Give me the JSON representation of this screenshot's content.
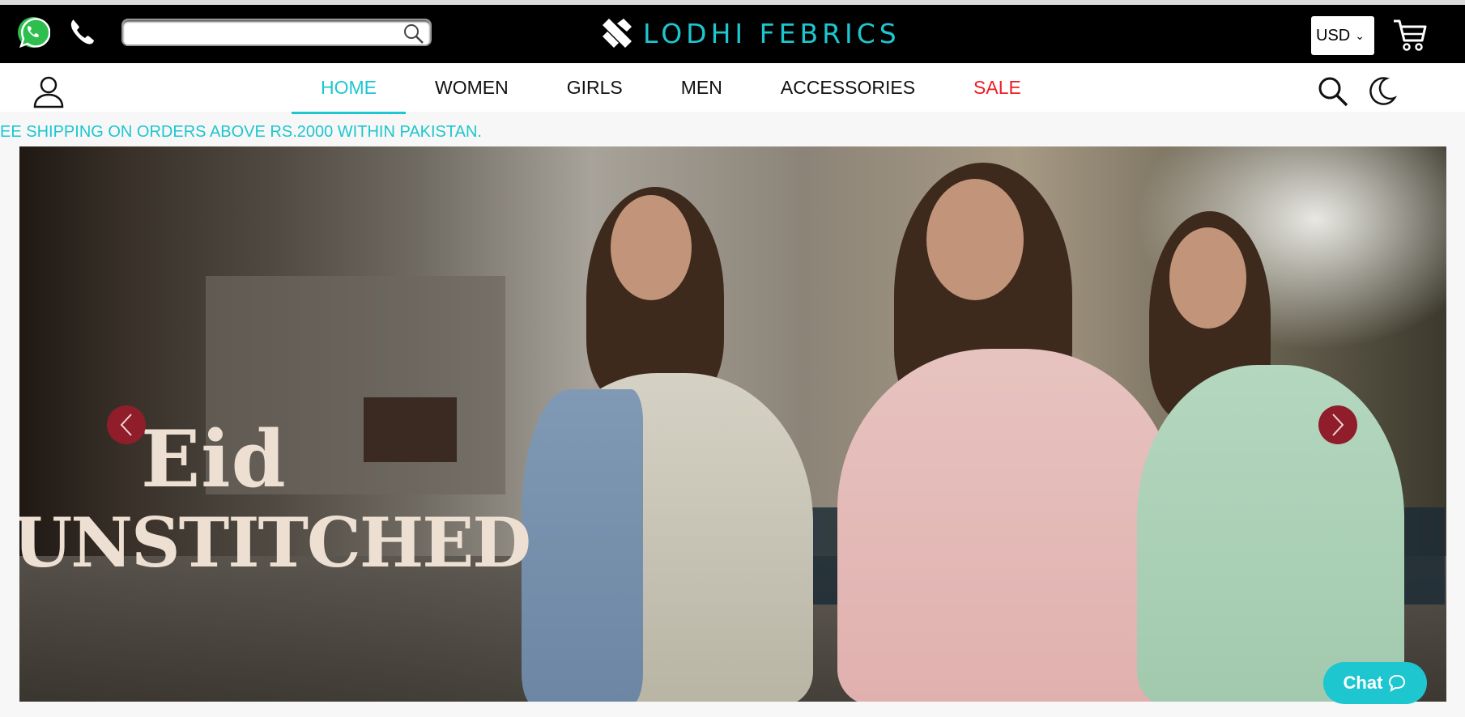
{
  "topbar": {
    "brand": "LODHI FEBRICS",
    "search_placeholder": "",
    "currency": "USD",
    "icons": [
      "whatsapp-icon",
      "phone-icon",
      "search-icon",
      "cart-icon"
    ]
  },
  "nav": {
    "items": [
      {
        "label": "HOME",
        "active": true
      },
      {
        "label": "WOMEN"
      },
      {
        "label": "GIRLS"
      },
      {
        "label": "MEN"
      },
      {
        "label": "ACCESSORIES"
      },
      {
        "label": "SALE"
      }
    ]
  },
  "promo": {
    "text": "EE SHIPPING ON ORDERS ABOVE RS.2000 WITHIN PAKISTAN."
  },
  "hero": {
    "line1": "Eid",
    "line2": "UNSTITCHED"
  },
  "chat": {
    "label": "Chat"
  },
  "colors": {
    "accent": "#1ec6cf",
    "sale": "#ee1c25",
    "slider_arrow": "#8f1d2a"
  }
}
